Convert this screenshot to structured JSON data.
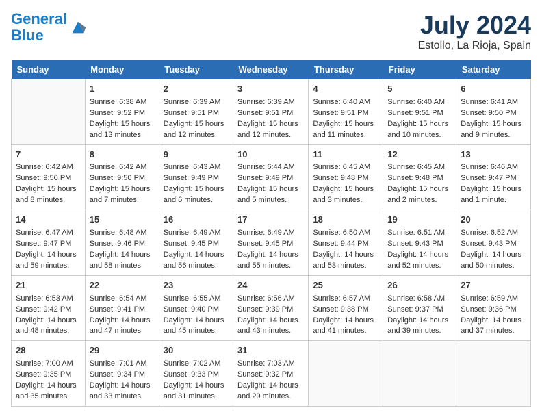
{
  "header": {
    "logo_line1": "General",
    "logo_line2": "Blue",
    "month": "July 2024",
    "location": "Estollo, La Rioja, Spain"
  },
  "weekdays": [
    "Sunday",
    "Monday",
    "Tuesday",
    "Wednesday",
    "Thursday",
    "Friday",
    "Saturday"
  ],
  "weeks": [
    [
      {
        "day": "",
        "data": ""
      },
      {
        "day": "1",
        "data": "Sunrise: 6:38 AM\nSunset: 9:52 PM\nDaylight: 15 hours and 13 minutes."
      },
      {
        "day": "2",
        "data": "Sunrise: 6:39 AM\nSunset: 9:51 PM\nDaylight: 15 hours and 12 minutes."
      },
      {
        "day": "3",
        "data": "Sunrise: 6:39 AM\nSunset: 9:51 PM\nDaylight: 15 hours and 12 minutes."
      },
      {
        "day": "4",
        "data": "Sunrise: 6:40 AM\nSunset: 9:51 PM\nDaylight: 15 hours and 11 minutes."
      },
      {
        "day": "5",
        "data": "Sunrise: 6:40 AM\nSunset: 9:51 PM\nDaylight: 15 hours and 10 minutes."
      },
      {
        "day": "6",
        "data": "Sunrise: 6:41 AM\nSunset: 9:50 PM\nDaylight: 15 hours and 9 minutes."
      }
    ],
    [
      {
        "day": "7",
        "data": "Sunrise: 6:42 AM\nSunset: 9:50 PM\nDaylight: 15 hours and 8 minutes."
      },
      {
        "day": "8",
        "data": "Sunrise: 6:42 AM\nSunset: 9:50 PM\nDaylight: 15 hours and 7 minutes."
      },
      {
        "day": "9",
        "data": "Sunrise: 6:43 AM\nSunset: 9:49 PM\nDaylight: 15 hours and 6 minutes."
      },
      {
        "day": "10",
        "data": "Sunrise: 6:44 AM\nSunset: 9:49 PM\nDaylight: 15 hours and 5 minutes."
      },
      {
        "day": "11",
        "data": "Sunrise: 6:45 AM\nSunset: 9:48 PM\nDaylight: 15 hours and 3 minutes."
      },
      {
        "day": "12",
        "data": "Sunrise: 6:45 AM\nSunset: 9:48 PM\nDaylight: 15 hours and 2 minutes."
      },
      {
        "day": "13",
        "data": "Sunrise: 6:46 AM\nSunset: 9:47 PM\nDaylight: 15 hours and 1 minute."
      }
    ],
    [
      {
        "day": "14",
        "data": "Sunrise: 6:47 AM\nSunset: 9:47 PM\nDaylight: 14 hours and 59 minutes."
      },
      {
        "day": "15",
        "data": "Sunrise: 6:48 AM\nSunset: 9:46 PM\nDaylight: 14 hours and 58 minutes."
      },
      {
        "day": "16",
        "data": "Sunrise: 6:49 AM\nSunset: 9:45 PM\nDaylight: 14 hours and 56 minutes."
      },
      {
        "day": "17",
        "data": "Sunrise: 6:49 AM\nSunset: 9:45 PM\nDaylight: 14 hours and 55 minutes."
      },
      {
        "day": "18",
        "data": "Sunrise: 6:50 AM\nSunset: 9:44 PM\nDaylight: 14 hours and 53 minutes."
      },
      {
        "day": "19",
        "data": "Sunrise: 6:51 AM\nSunset: 9:43 PM\nDaylight: 14 hours and 52 minutes."
      },
      {
        "day": "20",
        "data": "Sunrise: 6:52 AM\nSunset: 9:43 PM\nDaylight: 14 hours and 50 minutes."
      }
    ],
    [
      {
        "day": "21",
        "data": "Sunrise: 6:53 AM\nSunset: 9:42 PM\nDaylight: 14 hours and 48 minutes."
      },
      {
        "day": "22",
        "data": "Sunrise: 6:54 AM\nSunset: 9:41 PM\nDaylight: 14 hours and 47 minutes."
      },
      {
        "day": "23",
        "data": "Sunrise: 6:55 AM\nSunset: 9:40 PM\nDaylight: 14 hours and 45 minutes."
      },
      {
        "day": "24",
        "data": "Sunrise: 6:56 AM\nSunset: 9:39 PM\nDaylight: 14 hours and 43 minutes."
      },
      {
        "day": "25",
        "data": "Sunrise: 6:57 AM\nSunset: 9:38 PM\nDaylight: 14 hours and 41 minutes."
      },
      {
        "day": "26",
        "data": "Sunrise: 6:58 AM\nSunset: 9:37 PM\nDaylight: 14 hours and 39 minutes."
      },
      {
        "day": "27",
        "data": "Sunrise: 6:59 AM\nSunset: 9:36 PM\nDaylight: 14 hours and 37 minutes."
      }
    ],
    [
      {
        "day": "28",
        "data": "Sunrise: 7:00 AM\nSunset: 9:35 PM\nDaylight: 14 hours and 35 minutes."
      },
      {
        "day": "29",
        "data": "Sunrise: 7:01 AM\nSunset: 9:34 PM\nDaylight: 14 hours and 33 minutes."
      },
      {
        "day": "30",
        "data": "Sunrise: 7:02 AM\nSunset: 9:33 PM\nDaylight: 14 hours and 31 minutes."
      },
      {
        "day": "31",
        "data": "Sunrise: 7:03 AM\nSunset: 9:32 PM\nDaylight: 14 hours and 29 minutes."
      },
      {
        "day": "",
        "data": ""
      },
      {
        "day": "",
        "data": ""
      },
      {
        "day": "",
        "data": ""
      }
    ]
  ]
}
